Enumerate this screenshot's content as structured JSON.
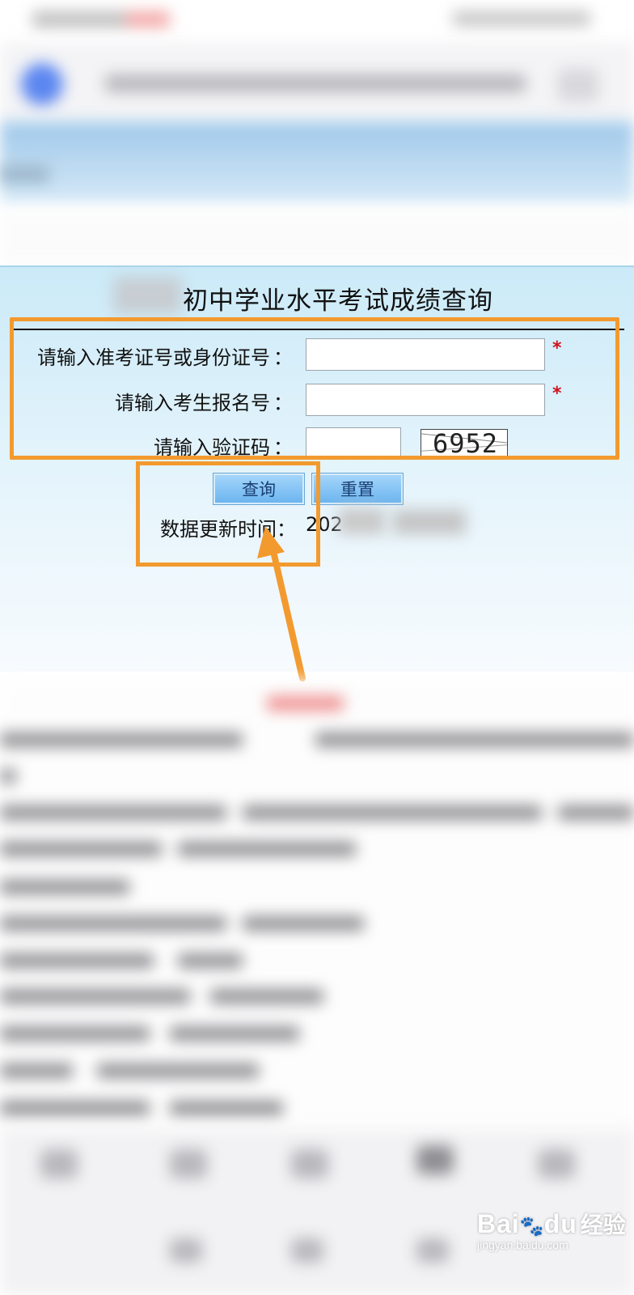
{
  "page": {
    "title": "初中学业水平考试成绩查询"
  },
  "form": {
    "exam_or_id_label": "请输入准考证号或身份证号",
    "registration_label": "请输入考生报名号",
    "captcha_label": "请输入验证码",
    "colon": "：",
    "required_mark": "*",
    "exam_or_id_value": "",
    "registration_value": "",
    "captcha_value": "",
    "captcha_code": "6952"
  },
  "buttons": {
    "query_label": "查询",
    "reset_label": "重置"
  },
  "update": {
    "label": "数据更新时间：",
    "value_visible": "202"
  },
  "watermark": {
    "brand": "Bai",
    "brand_suffix": "du",
    "brand_cn": "经验",
    "domain": "jingyan.baidu.com"
  },
  "colors": {
    "annotation": "#f39a2f",
    "required": "#d0101c",
    "button": "#68b3ef"
  }
}
